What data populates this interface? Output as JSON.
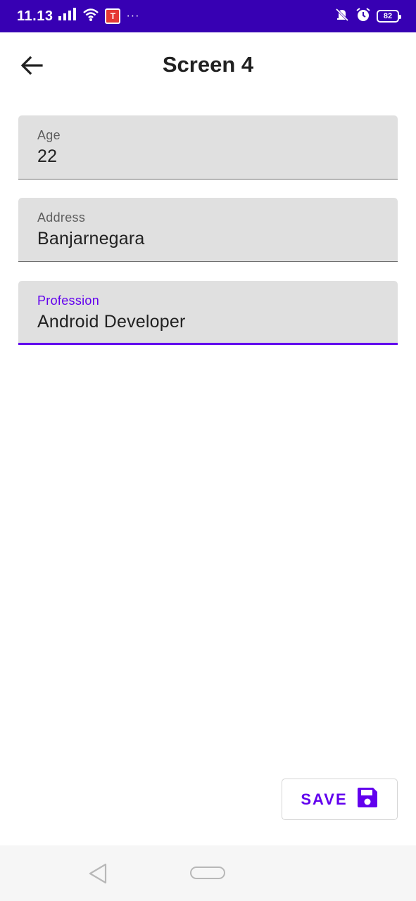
{
  "status_bar": {
    "time": "11.13",
    "app_badge": "T",
    "more_dots": "···",
    "battery_level": "82"
  },
  "header": {
    "title": "Screen 4",
    "back_icon": "arrow-left-icon"
  },
  "form": {
    "age": {
      "label": "Age",
      "value": "22"
    },
    "address": {
      "label": "Address",
      "value": "Banjarnegara"
    },
    "profession": {
      "label": "Profession",
      "value": "Android Developer"
    }
  },
  "save": {
    "label": "SAVE",
    "icon": "floppy-disk-icon"
  },
  "nav_bar": {
    "back_icon": "triangle-back-icon",
    "home_icon": "pill-home-icon"
  },
  "colors": {
    "status_bar": "#3700b3",
    "accent": "#6200ee",
    "field_bg": "#e0e0e0"
  }
}
